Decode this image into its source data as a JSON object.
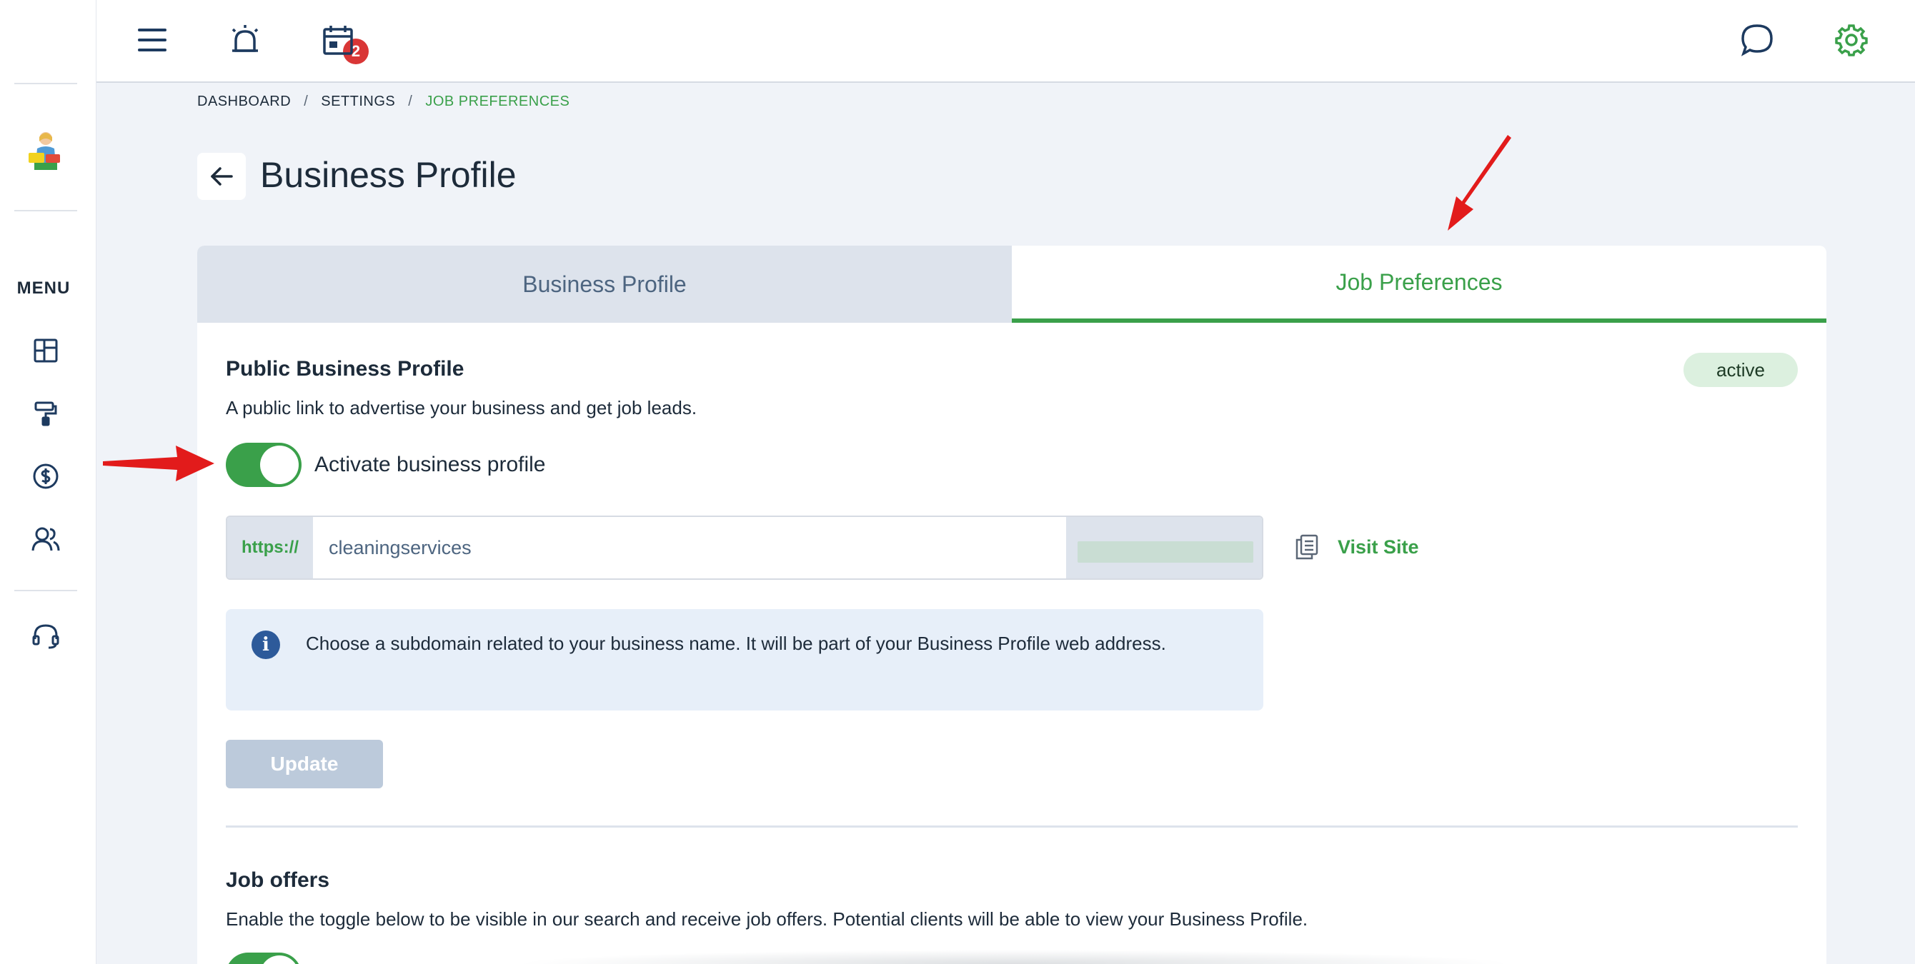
{
  "topbar": {
    "notifications_badge": "2"
  },
  "sidebar": {
    "menu_label": "MENU",
    "items": [
      {
        "icon": "dashboard-icon"
      },
      {
        "icon": "paint-roller-icon"
      },
      {
        "icon": "dollar-icon"
      },
      {
        "icon": "users-icon"
      },
      {
        "icon": "headset-icon"
      }
    ]
  },
  "breadcrumb": {
    "items": [
      "DASHBOARD",
      "SETTINGS",
      "JOB PREFERENCES"
    ],
    "separator": "/"
  },
  "page": {
    "title": "Business Profile"
  },
  "tabs": [
    {
      "label": "Business Profile",
      "active": false
    },
    {
      "label": "Job Preferences",
      "active": true
    }
  ],
  "public_profile": {
    "title": "Public Business Profile",
    "description": "A public link to advertise your business and get job leads.",
    "status": "active",
    "toggle_label": "Activate business profile",
    "toggle_on": true,
    "url_prefix": "https://",
    "url_value": "cleaningservices",
    "visit_site_label": "Visit Site",
    "info_text": "Choose a subdomain related to your business name. It will be part of your Business Profile web address.",
    "update_label": "Update"
  },
  "job_offers": {
    "title": "Job offers",
    "description": "Enable the toggle below to be visible in our search and receive job offers. Potential clients will be able to view your Business Profile.",
    "toggle_on": true
  },
  "colors": {
    "accent_green": "#3aa04a",
    "badge_red": "#d93636",
    "annotation_red": "#e21b1b"
  }
}
